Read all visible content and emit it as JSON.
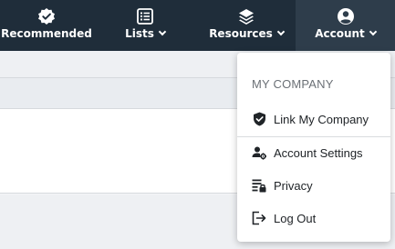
{
  "nav": {
    "items": [
      {
        "label": "Recommended",
        "icon": "verified-badge-icon",
        "chevron": false
      },
      {
        "label": "Lists",
        "icon": "list-icon",
        "chevron": true
      },
      {
        "label": "Resources",
        "icon": "layers-icon",
        "chevron": true
      },
      {
        "label": "Account",
        "icon": "account-circle-icon",
        "chevron": true
      }
    ],
    "active": "Account"
  },
  "account_menu": {
    "header": "MY COMPANY",
    "items": [
      {
        "label": "Link My Company",
        "icon": "shield-check-icon"
      },
      {
        "label": "Account Settings",
        "icon": "user-settings-icon"
      },
      {
        "label": "Privacy",
        "icon": "privacy-lock-icon"
      },
      {
        "label": "Log Out",
        "icon": "logout-icon"
      }
    ]
  },
  "colors": {
    "nav_bg": "#1f2d3a",
    "nav_active_bg": "#2e3d4b",
    "menu_text": "#202428",
    "menu_header": "#6b7076"
  }
}
